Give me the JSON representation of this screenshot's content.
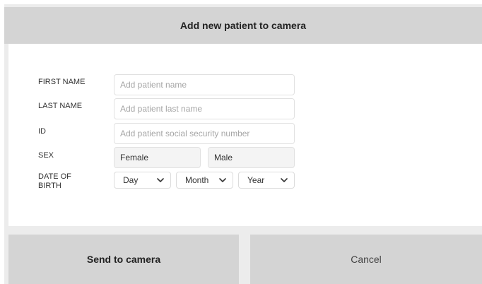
{
  "dialog": {
    "title": "Add new patient to camera"
  },
  "form": {
    "first_name": {
      "label": "FIRST NAME",
      "placeholder": "Add patient name",
      "value": ""
    },
    "last_name": {
      "label": "LAST NAME",
      "placeholder": "Add patient last name",
      "value": ""
    },
    "id": {
      "label": "ID",
      "placeholder": "Add patient social security number",
      "value": ""
    },
    "sex": {
      "label": "SEX",
      "options": [
        "Female",
        "Male"
      ]
    },
    "dob": {
      "label_line1": "DATE OF",
      "label_line2": "BIRTH",
      "day": "Day",
      "month": "Month",
      "year": "Year"
    }
  },
  "actions": {
    "send_label": "Send to camera",
    "cancel_label": "Cancel"
  },
  "icons": {
    "dropdown": "chevron-down-icon"
  },
  "colors": {
    "header_bg": "#d4d4d4",
    "button_bg": "#d4d4d4",
    "field_border": "#e1e1e1",
    "placeholder": "#a6a6a6"
  }
}
